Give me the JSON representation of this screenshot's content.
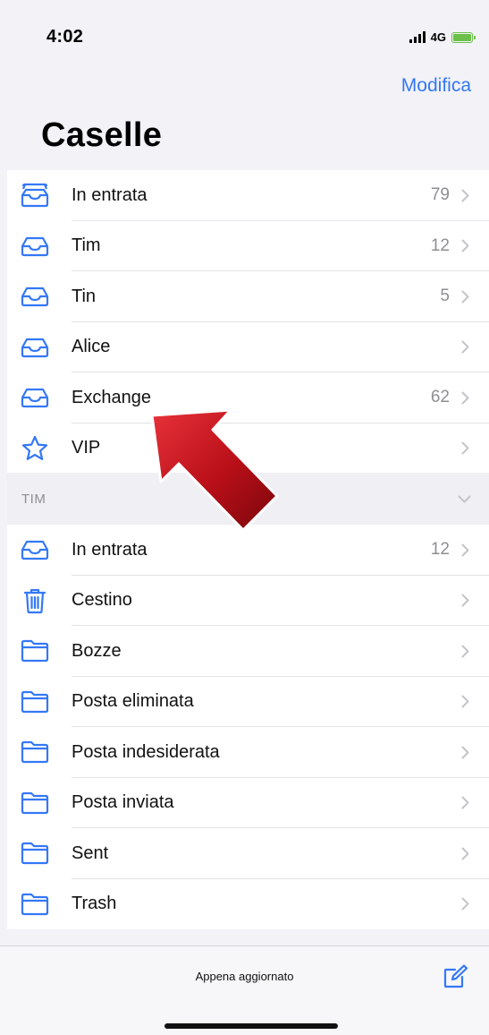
{
  "status_bar": {
    "time": "4:02",
    "network": "4G",
    "battery_color": "#6cc04a"
  },
  "nav": {
    "edit_label": "Modifica",
    "title": "Caselle"
  },
  "mailboxes": [
    {
      "label": "In entrata",
      "count": "79",
      "icon": "inbox-stack-icon"
    },
    {
      "label": "Tim",
      "count": "12",
      "icon": "inbox-icon"
    },
    {
      "label": "Tin",
      "count": "5",
      "icon": "inbox-icon"
    },
    {
      "label": "Alice",
      "count": "",
      "icon": "inbox-icon"
    },
    {
      "label": "Exchange",
      "count": "62",
      "icon": "inbox-icon"
    },
    {
      "label": "VIP",
      "count": "",
      "icon": "star-icon"
    }
  ],
  "tim_section": {
    "header": "TIM",
    "items": [
      {
        "label": "In entrata",
        "count": "12",
        "icon": "inbox-icon"
      },
      {
        "label": "Cestino",
        "count": "",
        "icon": "trash-icon"
      },
      {
        "label": "Bozze",
        "count": "",
        "icon": "folder-icon"
      },
      {
        "label": "Posta eliminata",
        "count": "",
        "icon": "folder-icon"
      },
      {
        "label": "Posta indesiderata",
        "count": "",
        "icon": "folder-icon"
      },
      {
        "label": "Posta inviata",
        "count": "",
        "icon": "folder-icon"
      },
      {
        "label": "Sent",
        "count": "",
        "icon": "folder-icon"
      },
      {
        "label": "Trash",
        "count": "",
        "icon": "folder-icon"
      }
    ]
  },
  "toolbar": {
    "status": "Appena aggiornato"
  },
  "colors": {
    "accent": "#3478f6",
    "arrow": "#c0141c"
  }
}
